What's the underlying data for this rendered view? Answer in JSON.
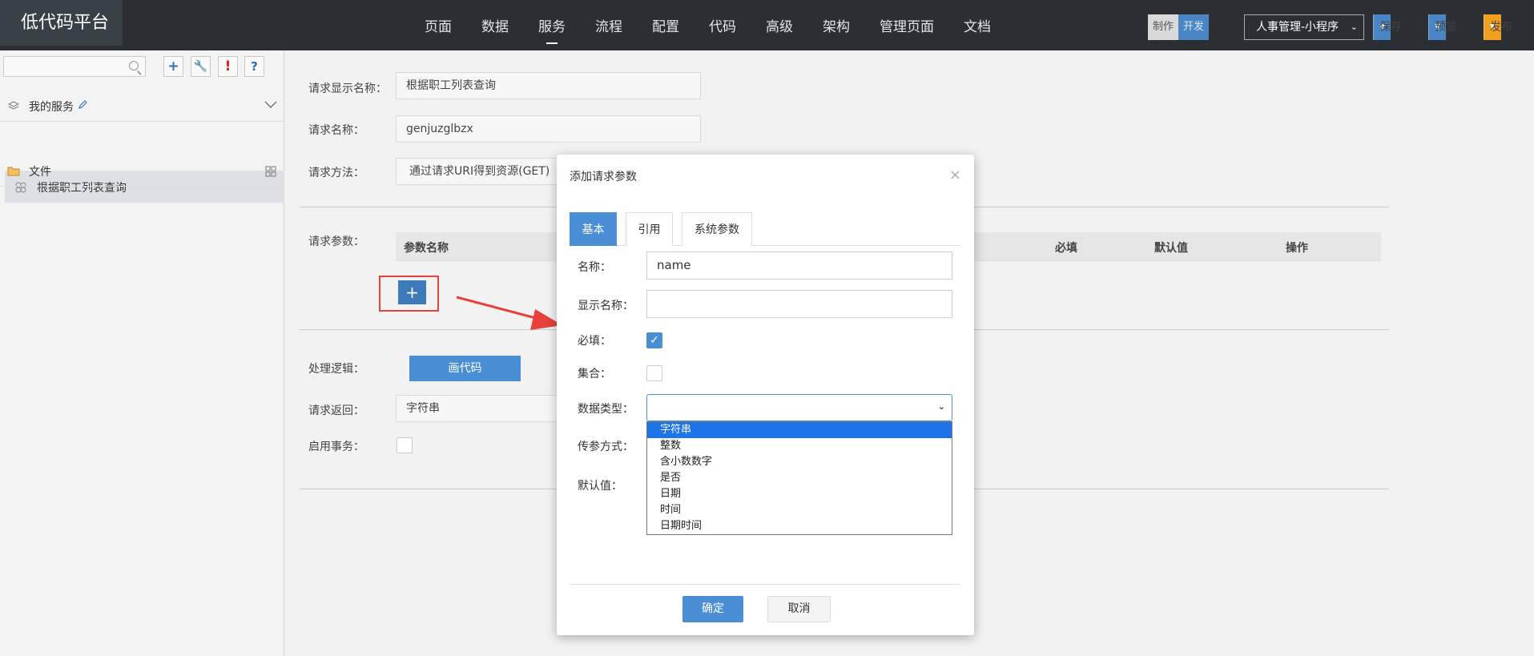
{
  "app": {
    "title": "低代码平台"
  },
  "nav": [
    "页面",
    "数据",
    "服务",
    "流程",
    "配置",
    "代码",
    "高级",
    "架构",
    "管理页面",
    "文档"
  ],
  "nav_active": "服务",
  "header": {
    "mode_make": "制作",
    "mode_dev": "开发",
    "app_select": "人事管理-小程序",
    "save": "保存",
    "preview": "预览",
    "publish": "发布"
  },
  "sidebar": {
    "search_placeholder": "",
    "tools": [
      "+",
      "wrench-icon",
      "!",
      "?"
    ],
    "groups": [
      {
        "label": "我的服务"
      },
      {
        "label": "文件"
      }
    ],
    "active_item": "根据职工列表查询"
  },
  "form": {
    "display_name_label": "请求显示名称：",
    "display_name_value": "根据职工列表查询",
    "name_label": "请求名称：",
    "name_value": "genjuzglbzx",
    "method_label": "请求方法：",
    "method_value": "通过请求URI得到资源(GET)",
    "params_label": "请求参数：",
    "params_columns": [
      "参数名称",
      "必填",
      "默认值",
      "操作"
    ],
    "add_param": "+",
    "logic_label": "处理逻辑：",
    "draw_code": "画代码",
    "return_label": "请求返回：",
    "return_value": "字符串",
    "tx_label": "启用事务："
  },
  "modal": {
    "title": "添加请求参数",
    "tabs": [
      "基本",
      "引用",
      "系统参数"
    ],
    "active_tab": "基本",
    "name_label": "名称：",
    "name_value": "name",
    "display_label": "显示名称：",
    "display_value": "",
    "required_label": "必填：",
    "required": true,
    "collection_label": "集合：",
    "collection": false,
    "type_label": "数据类型：",
    "type_value": "",
    "type_options": [
      "字符串",
      "整数",
      "含小数数字",
      "是否",
      "日期",
      "时间",
      "日期时间"
    ],
    "type_highlighted": "字符串",
    "pass_label": "传参方式：",
    "default_label": "默认值：",
    "ok": "确定",
    "cancel": "取消"
  },
  "colors": {
    "accent": "#4a8fd6",
    "topbar": "#2b2f33",
    "publish": "#f0a01e",
    "annotation": "#e8413b"
  }
}
